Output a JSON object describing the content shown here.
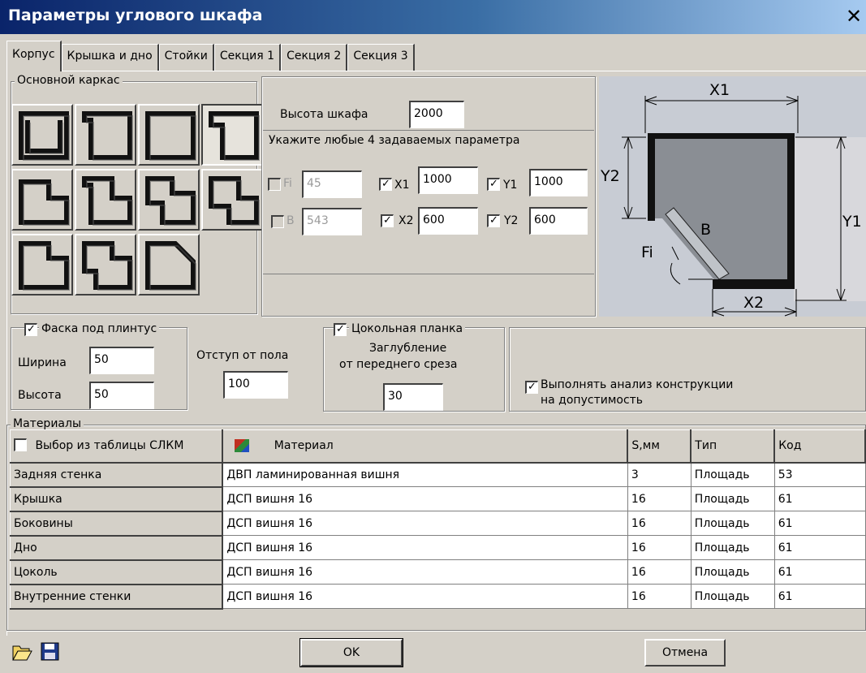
{
  "window": {
    "title": "Параметры углового шкафа",
    "close_glyph": "✕"
  },
  "tabs": [
    "Корпус",
    "Крышка и дно",
    "Стойки",
    "Секция 1",
    "Секция 2",
    "Секция 3"
  ],
  "frame_group": {
    "legend": "Основной каркас"
  },
  "height": {
    "label": "Высота шкафа",
    "value": "2000"
  },
  "params": {
    "legend": "Укажите любые 4 задаваемых параметра",
    "fi": {
      "label": "Fi",
      "value": "45",
      "checked": false
    },
    "b": {
      "label": "B",
      "value": "543",
      "checked": false
    },
    "x1": {
      "label": "X1",
      "value": "1000",
      "checked": true
    },
    "x2": {
      "label": "X2",
      "value": "600",
      "checked": true
    },
    "y1": {
      "label": "Y1",
      "value": "1000",
      "checked": true
    },
    "y2": {
      "label": "Y2",
      "value": "600",
      "checked": true
    }
  },
  "diagram": {
    "x1": "X1",
    "x2": "X2",
    "y1": "Y1",
    "y2": "Y2",
    "b": "B",
    "fi": "Fi"
  },
  "plinth": {
    "label": "Фаска под плинтус",
    "checked": true,
    "width_label": "Ширина",
    "width_value": "50",
    "height_label": "Высота",
    "height_value": "50"
  },
  "floor_offset": {
    "label": "Отступ от пола",
    "value": "100"
  },
  "base_strip": {
    "label": "Цокольная планка",
    "checked": true,
    "depth_line1": "Заглубление",
    "depth_line2": "от переднего среза",
    "value": "30"
  },
  "analysis": {
    "line1": "Выполнять анализ конструкции",
    "line2": "на допустимость",
    "checked": true
  },
  "materials": {
    "legend": "Материалы",
    "select_label": "Выбор из таблицы СЛКМ",
    "headers": {
      "material": "Материал",
      "s": "S,мм",
      "type": "Тип",
      "code": "Код"
    },
    "rows": [
      {
        "part": "Задняя стенка",
        "material": "ДВП ламинированная вишня",
        "s": "3",
        "type": "Площадь",
        "code": "53"
      },
      {
        "part": "Крышка",
        "material": "ДСП вишня 16",
        "s": "16",
        "type": "Площадь",
        "code": "61"
      },
      {
        "part": "Боковины",
        "material": "ДСП вишня 16",
        "s": "16",
        "type": "Площадь",
        "code": "61"
      },
      {
        "part": "Дно",
        "material": "ДСП вишня 16",
        "s": "16",
        "type": "Площадь",
        "code": "61"
      },
      {
        "part": "Цоколь",
        "material": "ДСП вишня 16",
        "s": "16",
        "type": "Площадь",
        "code": "61"
      },
      {
        "part": "Внутренние стенки",
        "material": "ДСП вишня 16",
        "s": "16",
        "type": "Площадь",
        "code": "61"
      }
    ]
  },
  "buttons": {
    "ok": "OK",
    "cancel": "Отмена"
  },
  "icons": {
    "open": "folder-open-icon",
    "save": "floppy-save-icon",
    "library": "material-library-icon"
  }
}
